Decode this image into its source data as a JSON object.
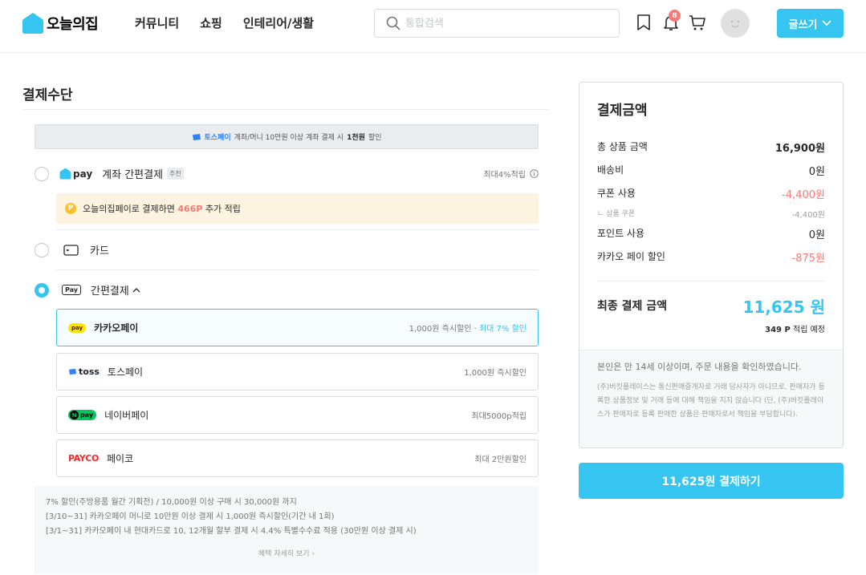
{
  "header": {
    "logo_text": "오늘의집",
    "nav": [
      "커뮤니티",
      "쇼핑",
      "인테리어/생활"
    ],
    "search_placeholder": "통합검색",
    "notification_count": "8",
    "write_label": "글쓰기"
  },
  "payment": {
    "section_title": "결제수단",
    "toss_banner": {
      "brand": "토스페이",
      "text": "계좌/머니 10만원 이상 계좌 결제 시",
      "highlight": "1천원",
      "suffix": "할인"
    },
    "ohpay": {
      "logo_text": "pay",
      "label": "계좌 간편결제",
      "tag": "추천",
      "benefit": "최대4%적립",
      "point_notice_prefix": "오늘의집페이로 결제하면",
      "point_notice_amount": "466P",
      "point_notice_suffix": "추가 적립"
    },
    "card": {
      "label": "카드"
    },
    "easy": {
      "label": "간편결제",
      "options": [
        {
          "logo": "pay",
          "name": "카카오페이",
          "benefit": "1,000원 즉시할인",
          "benefit_extra": "최대 7% 할인"
        },
        {
          "logo": "toss",
          "name": "토스페이",
          "benefit": "1,000원 즉시할인",
          "benefit_extra": ""
        },
        {
          "logo": "pay",
          "name": "네이버페이",
          "benefit": "최대5000p적립",
          "benefit_extra": ""
        },
        {
          "logo": "PAYCO",
          "name": "페이코",
          "benefit": "최대 2만원할인",
          "benefit_extra": ""
        }
      ]
    },
    "notice_lines": [
      "7% 할인(주방용품 월간 기획전) / 10,000원 이상 구매 시 30,000원 까지",
      "[3/10~31] 카카오페이 머니로 10만원 이상 결제 시 1,000원 즉시할인(기간 내 1회)",
      "[3/1~31] 카카오페이 내 현대카드로 10, 12개월 할부 결제 시 4.4% 특별수수료 적용 (30만원 이상 결제 시)"
    ],
    "notice_link": "혜택 자세히 보기"
  },
  "summary": {
    "title": "결제금액",
    "rows": [
      {
        "label": "총 상품 금액",
        "value": "16,900원"
      },
      {
        "label": "배송비",
        "value": "0원"
      },
      {
        "label": "쿠폰 사용",
        "value": "-4,400원"
      },
      {
        "label": "ㄴ 상품 쿠폰",
        "value": "-4,400원"
      },
      {
        "label": "포인트 사용",
        "value": "0원"
      },
      {
        "label": "카카오 페이 할인",
        "value": "-875원"
      }
    ],
    "final_label": "최종 결제 금액",
    "final_amount": "11,625 원",
    "final_point_amount": "349 P",
    "final_point_suffix": "적립 예정",
    "foot_notice": "본인은 만 14세 이상이며, 주문 내용을 확인하였습니다.",
    "foot_legal": "(주)버킷플레이스는 통신판매중개자로 거래 당사자가 아니므로, 판매자가 등록한 상품정보 및 거래 등에 대해 책임을 지지 않습니다 (단, (주)버킷플레이스가 판매자로 등록 판매한 상품은 판매자로서 책임을 부담합니다)."
  },
  "pay_button": "11,625원 결제하기",
  "colors": {
    "accent": "#35c5f0",
    "red": "#f77",
    "kakao": "#fee500",
    "naver": "#03c75a",
    "payco": "#fa2828",
    "toss": "#3182f6"
  }
}
